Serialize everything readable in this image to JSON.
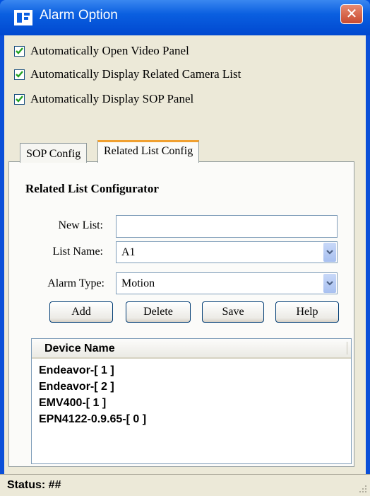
{
  "window": {
    "title": "Alarm Option",
    "close_label": "✕",
    "icon": "app-logo-icon"
  },
  "options": [
    {
      "label": "Automatically Open Video Panel",
      "checked": true
    },
    {
      "label": "Automatically Display Related Camera List",
      "checked": true
    },
    {
      "label": "Automatically Display SOP Panel",
      "checked": true
    }
  ],
  "tabs": [
    {
      "label": "SOP Config",
      "active": false
    },
    {
      "label": "Related List Config",
      "active": true
    }
  ],
  "configurator": {
    "title": "Related List Configurator",
    "new_list_label": "New List:",
    "new_list_value": "",
    "list_name_label": "List Name:",
    "list_name_value": "A1",
    "alarm_type_label": "Alarm Type:",
    "alarm_type_value": "Motion"
  },
  "buttons": {
    "add": "Add",
    "delete": "Delete",
    "save": "Save",
    "help": "Help"
  },
  "device_list": {
    "column_header": "Device Name",
    "rows": [
      "Endeavor-[ 1 ]",
      "Endeavor-[ 2 ]",
      "EMV400-[ 1 ]",
      "EPN4122-0.9.65-[ 0 ]"
    ]
  },
  "status": {
    "text": "Status:  ##"
  },
  "colors": {
    "title_bar": "#0a5fe0",
    "client_bg": "#ece9d8",
    "active_tab_accent": "#f0a030"
  }
}
